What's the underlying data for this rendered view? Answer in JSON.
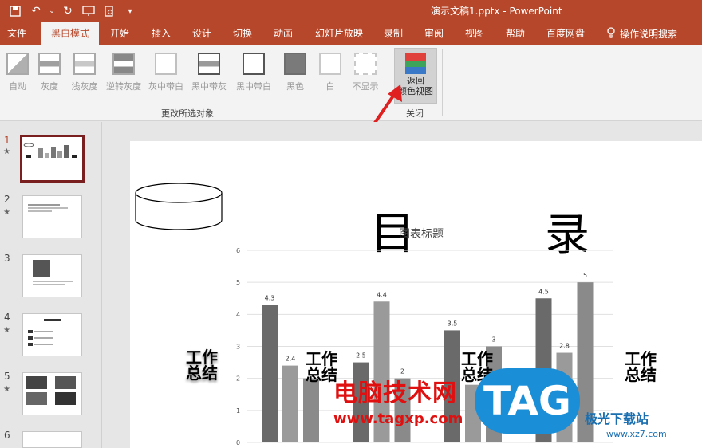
{
  "window": {
    "title": "演示文稿1.pptx  -  PowerPoint"
  },
  "tabs": [
    {
      "label": "文件"
    },
    {
      "label": "黑白模式"
    },
    {
      "label": "开始"
    },
    {
      "label": "插入"
    },
    {
      "label": "设计"
    },
    {
      "label": "切换"
    },
    {
      "label": "动画"
    },
    {
      "label": "幻灯片放映"
    },
    {
      "label": "录制"
    },
    {
      "label": "审阅"
    },
    {
      "label": "视图"
    },
    {
      "label": "帮助"
    },
    {
      "label": "百度网盘"
    }
  ],
  "tellme": {
    "label": "操作说明搜索"
  },
  "ribbon": {
    "change_group": {
      "label": "更改所选对象",
      "buttons": [
        {
          "label": "自动"
        },
        {
          "label": "灰度"
        },
        {
          "label": "浅灰度"
        },
        {
          "label": "逆转灰度"
        },
        {
          "label": "灰中带白"
        },
        {
          "label": "黑中带灰"
        },
        {
          "label": "黑中带白"
        },
        {
          "label": "黑色"
        },
        {
          "label": "白"
        },
        {
          "label": "不显示"
        }
      ]
    },
    "close_group": {
      "label": "关闭",
      "return_line1": "返回",
      "return_line2": "颜色视图"
    }
  },
  "thumbnails": [
    {
      "num": "1",
      "star": "★"
    },
    {
      "num": "2",
      "star": "★"
    },
    {
      "num": "3",
      "star": ""
    },
    {
      "num": "4",
      "star": "★"
    },
    {
      "num": "5",
      "star": "★"
    },
    {
      "num": "6",
      "star": ""
    }
  ],
  "slide": {
    "char_left": "目",
    "char_right": "录",
    "work_label": "工作\n总结"
  },
  "chart_data": {
    "type": "bar",
    "title": "图表标题",
    "ylim": [
      0,
      6
    ],
    "yticks": [
      "0",
      "1",
      "2",
      "3",
      "4",
      "5",
      "6"
    ],
    "series": [
      {
        "values": [
          4.3,
          2.5,
          3.5,
          4.5
        ],
        "color": "#6a6a6a"
      },
      {
        "values": [
          2.4,
          4.4,
          1.8,
          2.8
        ],
        "color": "#9a9a9a"
      },
      {
        "values": [
          2,
          2,
          3,
          5
        ],
        "color": "#8a8a8a"
      }
    ],
    "labels": [
      "4.3",
      "2.4",
      "",
      "2.5",
      "4.4",
      "2",
      "3.5",
      "",
      "3",
      "4.5",
      "2.8",
      "5"
    ]
  },
  "watermark": {
    "brand_cn": "电脑技术网",
    "url": "www.tagxp.com",
    "tag": "TAG",
    "site2": "极光下载站",
    "site2_url": "www.xz7.com"
  }
}
